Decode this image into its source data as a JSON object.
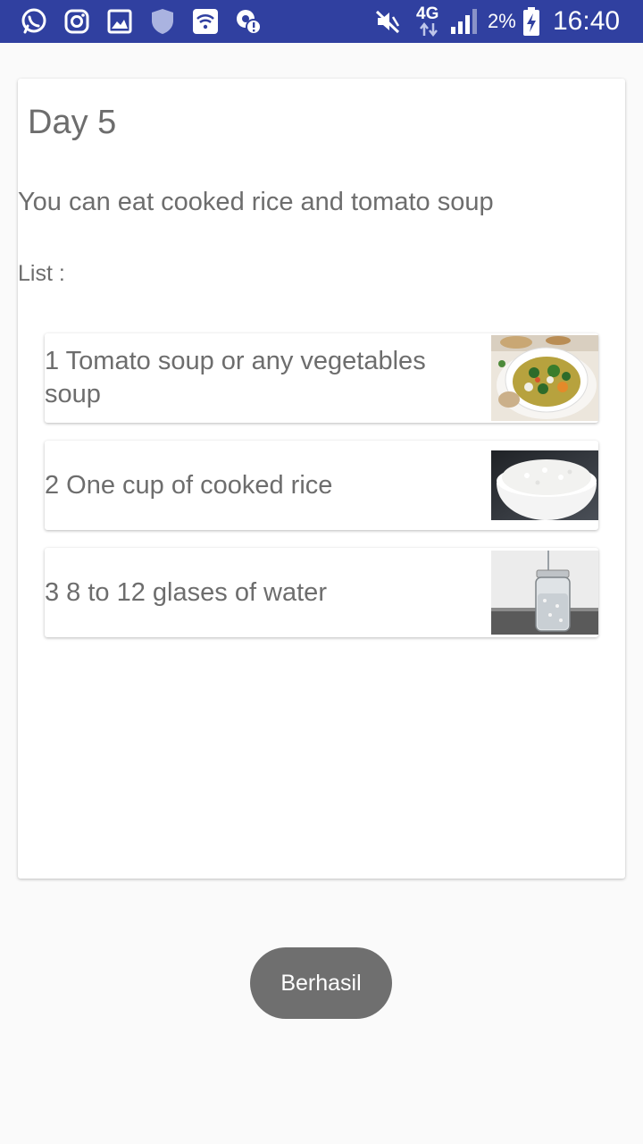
{
  "status_bar": {
    "network": "4G",
    "battery": "2%",
    "time": "16:40",
    "bg_color": "#3040a0",
    "left_icons": [
      "whatsapp-icon",
      "instagram-icon",
      "gallery-icon",
      "shield-icon",
      "wifi-icon",
      "location-alert-icon"
    ],
    "right_icons": [
      "muted-icon",
      "data-arrows-icon",
      "signal-icon",
      "battery-charging-icon"
    ]
  },
  "card": {
    "title": "Day 5",
    "description": "You can eat cooked rice and tomato soup",
    "list_label": "List :",
    "items": [
      {
        "label": "1 Tomato soup or any vegetables soup",
        "image": "vegetable-soup-image"
      },
      {
        "label": "2 One cup of cooked rice",
        "image": "rice-bowl-image"
      },
      {
        "label": "3 8 to 12 glases of water",
        "image": "water-jar-image"
      }
    ]
  },
  "toast": {
    "text": "Berhasil"
  }
}
